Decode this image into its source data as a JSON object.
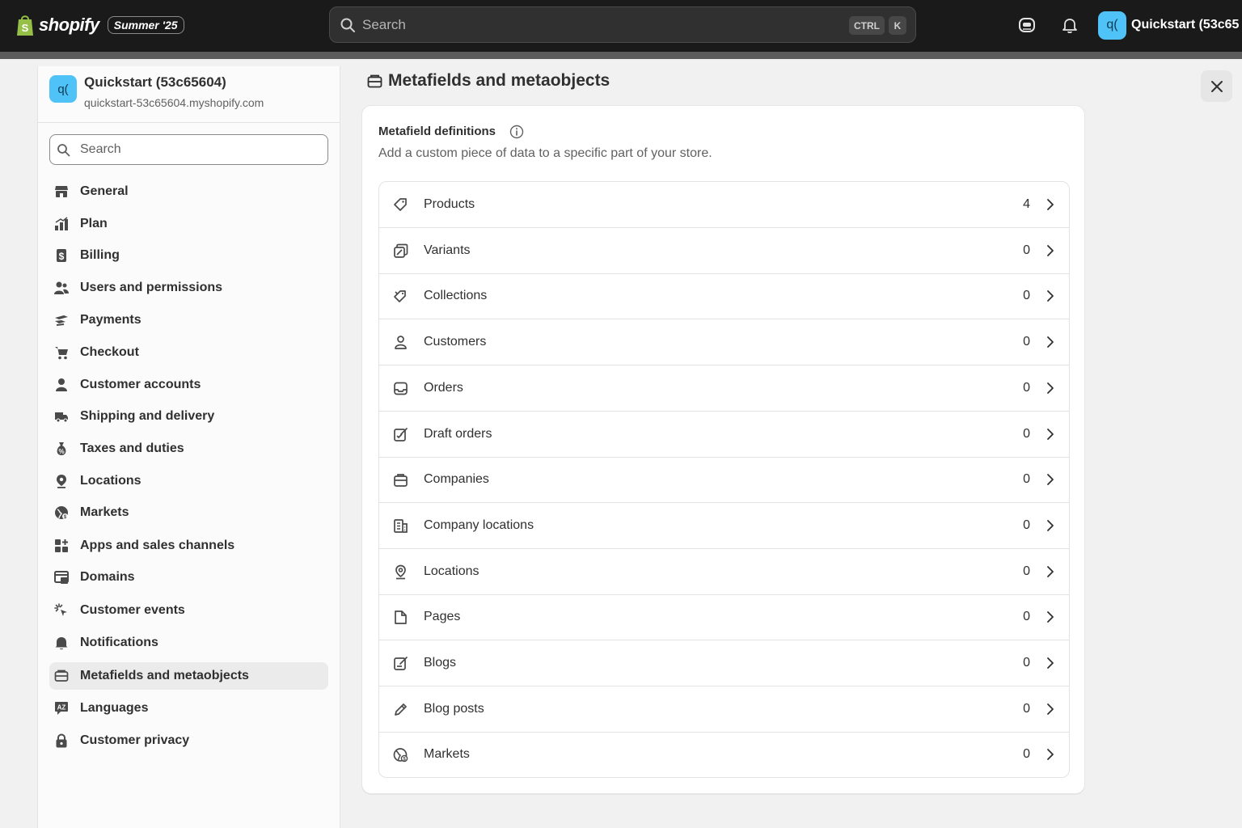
{
  "topbar": {
    "brand": "shopify",
    "edition": "Summer '25",
    "search_placeholder": "Search",
    "shortcut_ctrl": "CTRL",
    "shortcut_k": "K",
    "store_initials": "q(",
    "store_name": "Quickstart (53c65"
  },
  "sidebar": {
    "store_initials": "q(",
    "store_name": "Quickstart (53c65604)",
    "store_domain": "quickstart-53c65604.myshopify.com",
    "search_placeholder": "Search",
    "items": [
      {
        "label": "General",
        "icon": "store-icon"
      },
      {
        "label": "Plan",
        "icon": "plan-chart-icon"
      },
      {
        "label": "Billing",
        "icon": "billing-dollar-icon"
      },
      {
        "label": "Users and permissions",
        "icon": "users-icon"
      },
      {
        "label": "Payments",
        "icon": "payments-hand-icon"
      },
      {
        "label": "Checkout",
        "icon": "cart-icon"
      },
      {
        "label": "Customer accounts",
        "icon": "person-icon"
      },
      {
        "label": "Shipping and delivery",
        "icon": "truck-icon"
      },
      {
        "label": "Taxes and duties",
        "icon": "money-bag-icon"
      },
      {
        "label": "Locations",
        "icon": "location-pin-icon"
      },
      {
        "label": "Markets",
        "icon": "globe-icon"
      },
      {
        "label": "Apps and sales channels",
        "icon": "apps-icon"
      },
      {
        "label": "Domains",
        "icon": "domains-icon"
      },
      {
        "label": "Customer events",
        "icon": "cursor-click-icon"
      },
      {
        "label": "Notifications",
        "icon": "bell-icon"
      },
      {
        "label": "Metafields and metaobjects",
        "icon": "metafields-icon"
      },
      {
        "label": "Languages",
        "icon": "language-icon"
      },
      {
        "label": "Customer privacy",
        "icon": "lock-icon"
      }
    ],
    "active_item": "Metafields and metaobjects"
  },
  "main": {
    "title": "Metafields and metaobjects",
    "card_title": "Metafield definitions",
    "card_description": "Add a custom piece of data to a specific part of your store.",
    "rows": [
      {
        "label": "Products",
        "count": "4",
        "icon": "tag-icon"
      },
      {
        "label": "Variants",
        "count": "0",
        "icon": "variant-icon"
      },
      {
        "label": "Collections",
        "count": "0",
        "icon": "collections-icon"
      },
      {
        "label": "Customers",
        "count": "0",
        "icon": "person-icon"
      },
      {
        "label": "Orders",
        "count": "0",
        "icon": "inbox-icon"
      },
      {
        "label": "Draft orders",
        "count": "0",
        "icon": "draft-icon"
      },
      {
        "label": "Companies",
        "count": "0",
        "icon": "briefcase-icon"
      },
      {
        "label": "Company locations",
        "count": "0",
        "icon": "building-icon"
      },
      {
        "label": "Locations",
        "count": "0",
        "icon": "location-pin-icon"
      },
      {
        "label": "Pages",
        "count": "0",
        "icon": "page-icon"
      },
      {
        "label": "Blogs",
        "count": "0",
        "icon": "blog-icon"
      },
      {
        "label": "Blog posts",
        "count": "0",
        "icon": "pencil-icon"
      },
      {
        "label": "Markets",
        "count": "0",
        "icon": "globe-icon"
      }
    ]
  },
  "colors": {
    "topbar": "#1a1a1a",
    "accent_avatar": "#4fc3f7",
    "page_bg": "#f1f1f1",
    "text": "#303030",
    "muted_text": "#616161"
  }
}
